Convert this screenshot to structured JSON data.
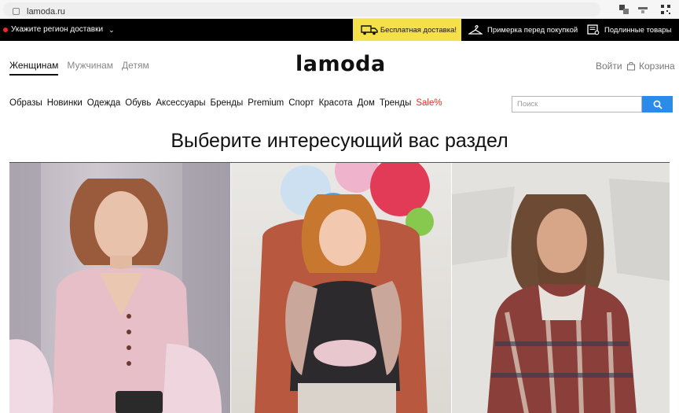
{
  "browser": {
    "url": "lamoda.ru"
  },
  "topbar": {
    "region": "Укажите регион доставки",
    "free_delivery": "Бесплатная доставка!",
    "try_on": "Примерка перед покупкой",
    "originals": "Подлинные товары"
  },
  "header": {
    "tabs": [
      "Женщинам",
      "Мужчинам",
      "Детям"
    ],
    "logo": "lamoda",
    "login": "Войти",
    "cart": "Корзина"
  },
  "nav": {
    "items": [
      "Образы",
      "Новинки",
      "Одежда",
      "Обувь",
      "Аксессуары",
      "Бренды",
      "Premium",
      "Спорт",
      "Красота",
      "Дом",
      "Тренды",
      "Sale%"
    ],
    "search_placeholder": "Поиск"
  },
  "main": {
    "headline": "Выберите интересующий вас раздел"
  },
  "colors": {
    "accent": "#2b8be8",
    "sale": "#e52b2b",
    "yellow": "#f6e049"
  }
}
